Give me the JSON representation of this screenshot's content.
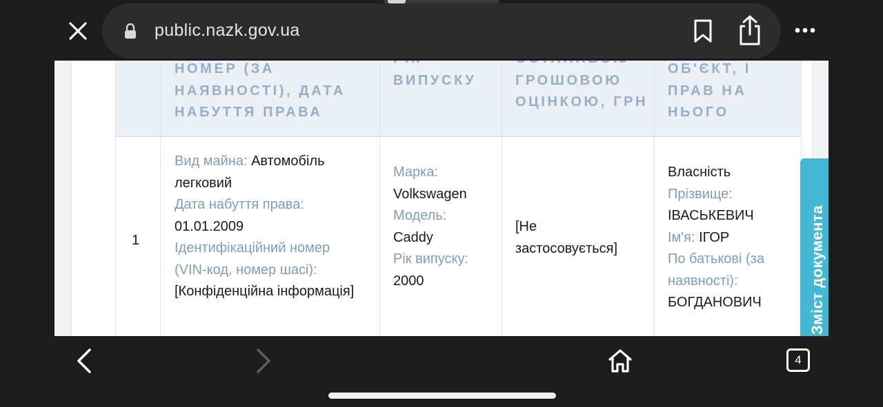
{
  "browser": {
    "url": "public.nazk.gov.ua",
    "tabs_count": "4"
  },
  "table": {
    "headers": {
      "col2": "НОМЕР (ЗА\nНАЯВНОСТІ), ДАТА\nНАБУТТЯ ПРАВА",
      "col3": "РІК\nВИПУСКУ",
      "col4": "ОСТАННЬОЮ\nГРОШОВОЮ\nОЦІНКОЮ, ГРН",
      "col5": "ОБ'ЄКТ, І\nПРАВ НА\nНЬОГО"
    },
    "row": {
      "num": "1",
      "property_type_label": "Вид майна:",
      "property_type_value": "Автомобіль легковий",
      "acquire_date_label": "Дата набуття права:",
      "acquire_date_value": "01.01.2009",
      "vin_label": "Ідентифікаційний номер (VIN-код, номер шасі):",
      "vin_value": "[Конфіденційна інформація]",
      "brand_label": "Марка:",
      "brand_value": "Volkswagen",
      "model_label": "Модель:",
      "model_value": "Caddy",
      "year_label": "Рік випуску:",
      "year_value": "2000",
      "valuation_value": "[Не застосовується]",
      "ownership_value": "Власність",
      "surname_label": "Прізвище:",
      "surname_value": "ІВАСЬКЕВИЧ",
      "name_label": "Ім'я:",
      "name_value": "ІГОР",
      "patronymic_label": "По батькові (за наявності):",
      "patronymic_value": "БОГДАНОВИЧ"
    }
  },
  "side_tab": {
    "label": "Зміст документа"
  },
  "colors": {
    "label": "#7f9db8",
    "header_text": "#97aec4",
    "side_tab": "#44b8d4"
  }
}
